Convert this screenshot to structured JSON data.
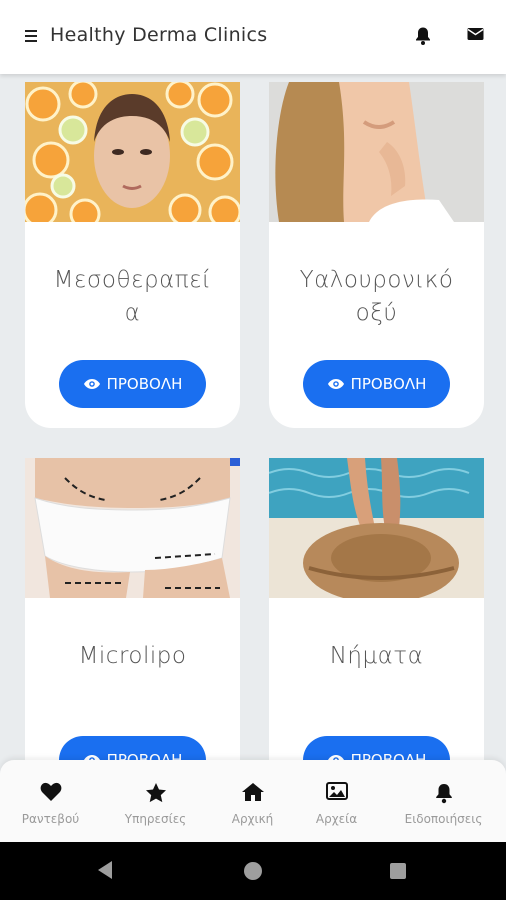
{
  "header": {
    "title": "Healthy Derma Clinics"
  },
  "icons": {
    "menu": "hamburger-icon",
    "notifications": "bell-icon",
    "messages": "envelope-icon"
  },
  "colors": {
    "accent": "#1a6ff0",
    "background": "#e9ecee"
  },
  "cards": [
    {
      "title": "Μεσοθεραπεί\nα",
      "button": "ΠΡΟΒΟΛΗ",
      "image": "woman-face-with-orange-slices"
    },
    {
      "title": "Υαλουρονικό\nοξύ",
      "button": "ΠΡΟΒΟΛΗ",
      "image": "woman-neck-shoulder"
    },
    {
      "title": "Microlipo",
      "button": "ΠΡΟΒΟΛΗ",
      "image": "body-contour-markings"
    },
    {
      "title": "Νήματα",
      "button": "ΠΡΟΒΟΛΗ",
      "image": "sun-hat-by-pool"
    }
  ],
  "bottom_nav": [
    {
      "label": "Ραντεβού",
      "icon": "heart-icon"
    },
    {
      "label": "Υπηρεσίες",
      "icon": "star-icon"
    },
    {
      "label": "Αρχική",
      "icon": "home-icon"
    },
    {
      "label": "Αρχεία",
      "icon": "image-icon"
    },
    {
      "label": "Ειδοποιήσεις",
      "icon": "bell-icon"
    }
  ]
}
